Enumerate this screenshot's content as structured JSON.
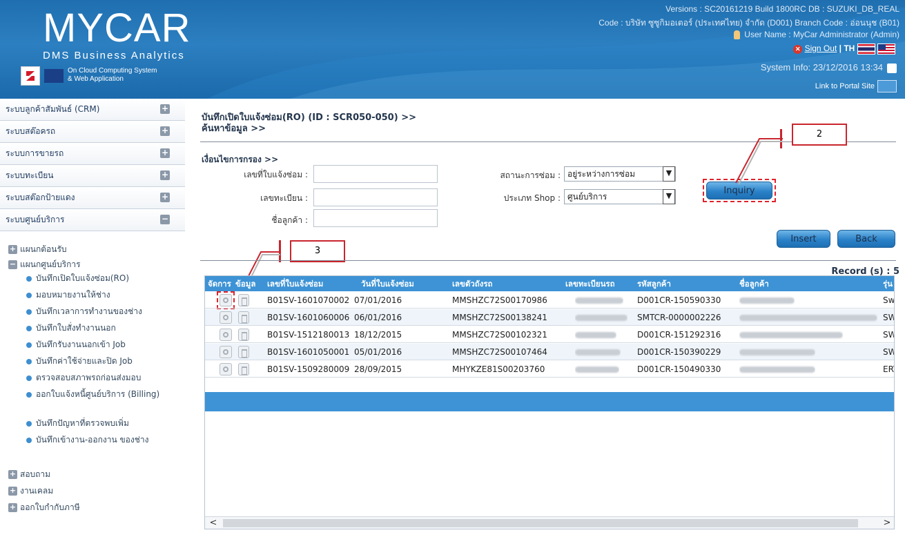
{
  "header": {
    "logo": "MYCAR",
    "logo_sub": "DMS Business Analytics",
    "tagline1": "On Cloud Computing System",
    "tagline2": "& Web Application",
    "versions": "Versions : SC20161219 Build 1800RC DB : SUZUKI_DB_REAL",
    "dealer": "Code : บริษัท ซูซูกิมอเตอร์ (ประเทศไทย) จำกัด (D001)  Branch Code : อ่อนนุช (B01)",
    "user": "User Name : MyCar Administrator  (Admin)",
    "sign_out": "Sign Out",
    "lang": "| TH",
    "system_info": "System Info: 23/12/2016 13:34",
    "portal": "Link to Portal Site"
  },
  "sidebar": {
    "menus": [
      {
        "label": "ระบบลูกค้าสัมพันธ์ (CRM)",
        "toggle": "+"
      },
      {
        "label": "ระบบสต๊อครถ",
        "toggle": "+"
      },
      {
        "label": "ระบบการขายรถ",
        "toggle": "+"
      },
      {
        "label": "ระบบทะเบียน",
        "toggle": "+"
      },
      {
        "label": "ระบบสต๊อกป้ายแดง",
        "toggle": "+"
      },
      {
        "label": "ระบบศูนย์บริการ",
        "toggle": "−"
      }
    ],
    "reception": "แผนกต้อนรับ",
    "service_dept": "แผนกศูนย์บริการ",
    "service_items": [
      "บันทึกเปิดใบแจ้งซ่อม(RO)",
      "มอบหมายงานให้ช่าง",
      "บันทึกเวลาการทำงานของช่าง",
      "บันทึกใบสั่งทำงานนอก",
      "บันทึกรับงานนอกเข้า Job",
      "บันทึกค่าใช้จ่ายและปิด Job",
      "ตรวจสอบสภาพรถก่อนส่งมอบ",
      "ออกใบแจ้งหนี้ศูนย์บริการ (Billing)",
      "บันทึกปัญหาที่ตรวจพบเพิ่ม",
      "บันทึกเข้างาน-ออกงาน ของช่าง"
    ],
    "inquiry": "สอบถาม",
    "claim": "งานเคลม",
    "tax_invoice": "ออกใบกำกับภาษี"
  },
  "main": {
    "title_line1": "บันทึกเปิดใบแจ้งซ่อม(RO) (ID : SCR050-050)  >>",
    "title_line2": "ค้นหาข้อมูล >>",
    "filter_title": "เงื่อนไขการกรอง >>",
    "ro_no_label": "เลขที่ใบแจ้งซ่อม :",
    "plate_label": "เลขทะเบียน :",
    "customer_label": "ชื่อลูกค้า :",
    "ro_no_value": "",
    "plate_value": "",
    "customer_value": "",
    "repair_status_label": "สถานะการซ่อม :",
    "repair_status_value": "อยู่ระหว่างการซ่อม",
    "shop_type_label": "ประเภท Shop :",
    "shop_type_value": "ศูนย์บริการ",
    "inquiry_btn": "Inquiry",
    "insert_btn": "Insert",
    "back_btn": "Back",
    "callout_2": "2",
    "callout_3": "3",
    "record": "Record (s) : 5"
  },
  "table": {
    "headers": [
      "จัดการ",
      "ข้อมูล",
      "เลขที่ใบแจ้งซ่อม",
      "วันที่ใบแจ้งซ่อม",
      "เลขตัวถังรถ",
      "เลขทะเบียนรถ",
      "รหัสลูกค้า",
      "ชื่อลูกค้า",
      "รุ่น"
    ],
    "rows": [
      {
        "ro": "B01SV-1601070002",
        "date": "07/01/2016",
        "vin": "MMSHZC72S00170986",
        "cust": "D001CR-150590330",
        "model": "Sw"
      },
      {
        "ro": "B01SV-1601060006",
        "date": "06/01/2016",
        "vin": "MMSHZC72S00138241",
        "cust": "SMTCR-0000002226",
        "model": "SW"
      },
      {
        "ro": "B01SV-1512180013",
        "date": "18/12/2015",
        "vin": "MMSHZC72S00102321",
        "cust": "D001CR-151292316",
        "model": "SW"
      },
      {
        "ro": "B01SV-1601050001",
        "date": "05/01/2016",
        "vin": "MMSHZC72S00107464",
        "cust": "D001CR-150390229",
        "model": "SW"
      },
      {
        "ro": "B01SV-1509280009",
        "date": "28/09/2015",
        "vin": "MHYKZE81S00203760",
        "cust": "D001CR-150490330",
        "model": "ERT"
      }
    ],
    "scroll_left": "<",
    "scroll_right": ">"
  }
}
